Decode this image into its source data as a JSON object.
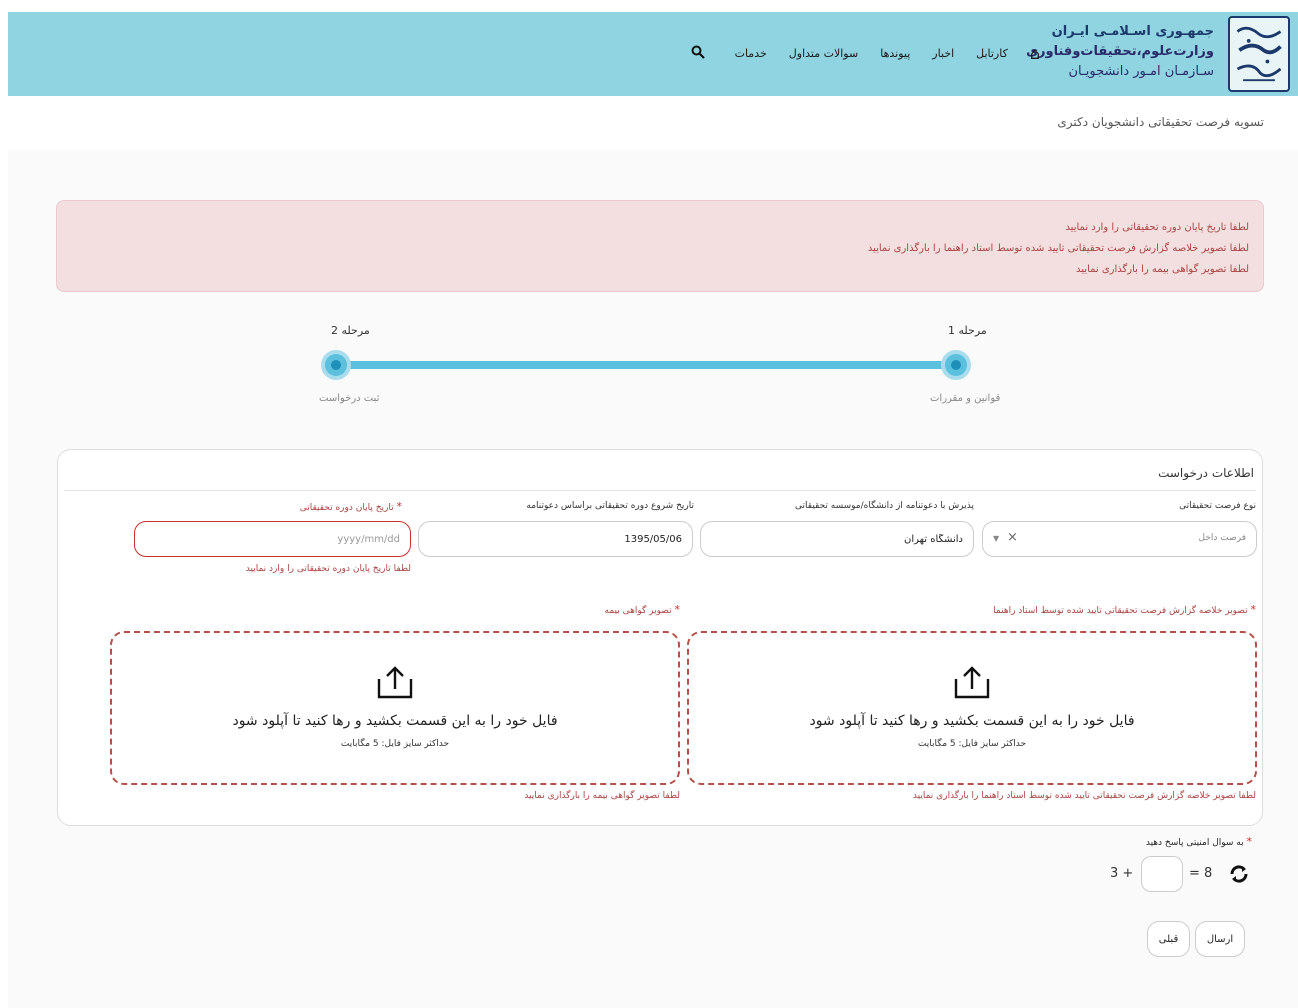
{
  "header": {
    "logo_line1": "جمهـوری اسـلامـی ایـران",
    "logo_line2": "وزارت‌علوم،تحقیقات‌وفناوری",
    "logo_line3": "سـازمـان امـور دانشجویـان",
    "logo_mark": "سازمان امور دانشجویان",
    "nav": [
      "کارتابل",
      "اخبار",
      "پیوندها",
      "سوالات متداول",
      "خدمات"
    ],
    "home_icon": "home-icon",
    "search_icon": "search-icon",
    "bg_color": "#8fd4e0"
  },
  "page_title": "تسویه فرصت تحقیقاتی دانشجویان دکتری",
  "alert": {
    "lines": [
      "لطفا تاریخ پایان دوره تحقیقاتی را وارد نمایید",
      "لطفا تصویر خلاصه گزارش فرصت تحقیقاتی تایید شده توسط استاد راهنما را بارگذاری نمایید",
      "لطفا تصویر گواهی بیمه را بارگذاری نمایید"
    ],
    "color": "#a94442"
  },
  "steps": [
    {
      "label": "مرحله 1",
      "sub": "قوانین و مقررات"
    },
    {
      "label": "مرحله 2",
      "sub": "ثبت درخواست"
    }
  ],
  "form": {
    "title": "اطلاعات درخواست",
    "type_label": "نوع فرصت تحقیقاتی",
    "type_value": "فرصت داخل",
    "admission_label": "پذیرش با دعوتنامه از دانشگاه/موسسه تحقیقاتی",
    "admission_value": "دانشگاه تهران",
    "start_label": "تاریخ شروع دوره تحقیقاتی براساس دعوتنامه",
    "start_value": "1395/05/06",
    "end_label": "تاریخ پایان دوره تحقیقاتی",
    "end_placeholder": "yyyy/mm/dd",
    "end_error": "لطفا تاریخ پایان دوره تحقیقاتی را وارد نمایید",
    "report_label": "تصویر خلاصه گزارش فرصت تحقیقاتی تایید شده توسط استاد راهنما",
    "report_error": "لطفا تصویر خلاصه گزارش فرصت تحقیقاتی تایید شده توسط استاد راهنما را بارگذاری نمایید",
    "insurance_label": "تصویر گواهی بیمه",
    "insurance_error": "لطفا تصویر گواهی بیمه را بارگذاری نمایید",
    "drop_text": "فایل خود را به این قسمت بکشید و رها کنید تا آپلود شود",
    "drop_sub": "حداکثر سایز فایل: 5 مگابایت"
  },
  "captcha": {
    "label": "به سوال امنیتی پاسخ دهید",
    "a": "3 +",
    "eq": "= 8",
    "answer": ""
  },
  "buttons": {
    "submit": "ارسال",
    "prev": "قبلی"
  }
}
